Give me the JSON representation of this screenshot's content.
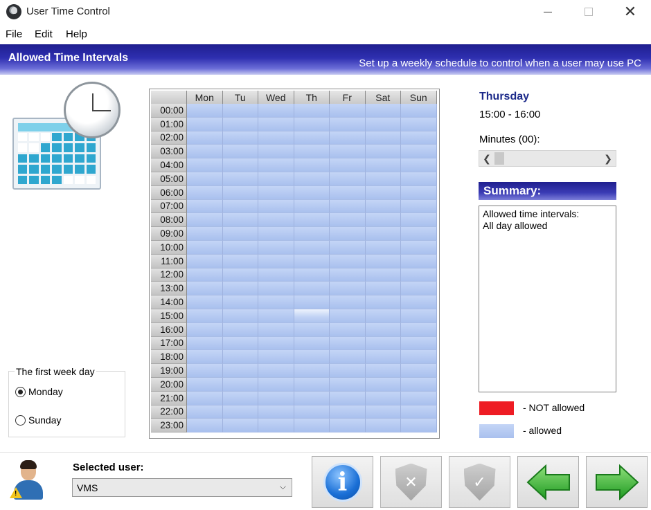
{
  "window": {
    "title": "User Time Control"
  },
  "menu": [
    "File",
    "Edit",
    "Help"
  ],
  "header": {
    "title": "Allowed Time Intervals",
    "subtitle": "Set up a weekly schedule to control when a user may use PC"
  },
  "first_week_day": {
    "legend": "The first week day",
    "options": [
      {
        "label": "Monday",
        "selected": true
      },
      {
        "label": "Sunday",
        "selected": false
      }
    ]
  },
  "schedule": {
    "days": [
      "Mon",
      "Tu",
      "Wed",
      "Th",
      "Fr",
      "Sat",
      "Sun"
    ],
    "hours": [
      "00:00",
      "01:00",
      "02:00",
      "03:00",
      "04:00",
      "05:00",
      "06:00",
      "07:00",
      "08:00",
      "09:00",
      "10:00",
      "11:00",
      "12:00",
      "13:00",
      "14:00",
      "15:00",
      "16:00",
      "17:00",
      "18:00",
      "19:00",
      "20:00",
      "21:00",
      "22:00",
      "23:00"
    ],
    "selected_cell": {
      "day": "Th",
      "hour": "15:00"
    }
  },
  "details": {
    "day": "Thursday",
    "time_range": "15:00 - 16:00",
    "minutes_label": "Minutes (00):"
  },
  "summary": {
    "title": "Summary:",
    "lines": [
      "Allowed time intervals:",
      "All day allowed"
    ]
  },
  "legend": {
    "not_allowed": {
      "label": "- NOT allowed",
      "color": "#ee1c24"
    },
    "allowed": {
      "label": "- allowed",
      "color": "#b6caf2"
    }
  },
  "user": {
    "label": "Selected user:",
    "value": "VMS"
  },
  "actions": {
    "info": "info-icon",
    "deny": "shield-x-icon",
    "allow": "shield-check-icon",
    "back": "arrow-left-icon",
    "next": "arrow-right-icon"
  }
}
